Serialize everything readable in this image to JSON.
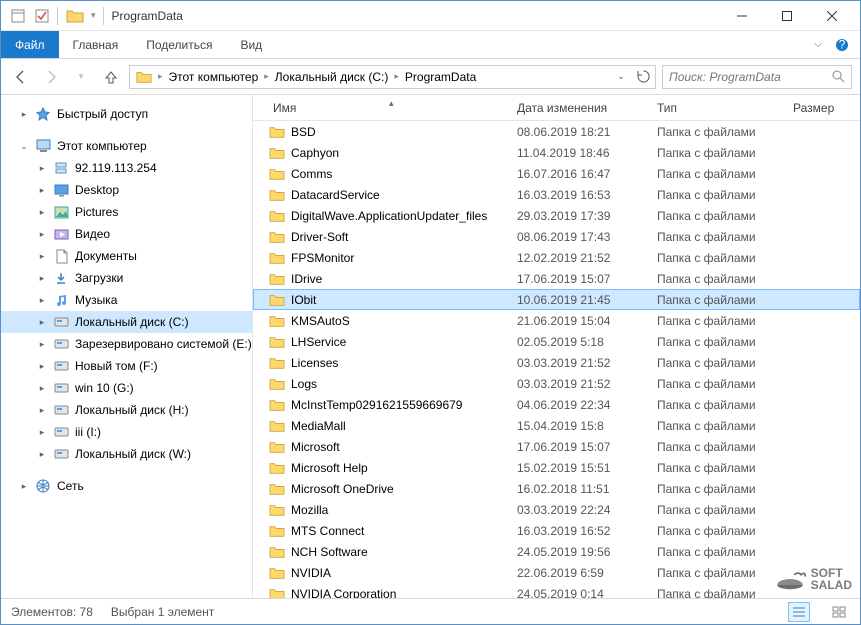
{
  "window": {
    "title": "ProgramData"
  },
  "ribbon": {
    "file": "Файл",
    "tabs": [
      "Главная",
      "Поделиться",
      "Вид"
    ]
  },
  "breadcrumb": [
    "Этот компьютер",
    "Локальный диск (C:)",
    "ProgramData"
  ],
  "search": {
    "placeholder": "Поиск: ProgramData"
  },
  "columns": {
    "name": "Имя",
    "date": "Дата изменения",
    "type": "Тип",
    "size": "Размер"
  },
  "sidebar": {
    "quick": "Быстрый доступ",
    "pc": "Этот компьютер",
    "network_ip": "92.119.113.254",
    "items": [
      "Desktop",
      "Pictures",
      "Видео",
      "Документы",
      "Загрузки",
      "Музыка"
    ],
    "localC": "Локальный диск (C:)",
    "drives": [
      "Зарезервировано системой (E:)",
      "Новый том (F:)",
      "win 10 (G:)",
      "Локальный диск (H:)",
      "iii (I:)",
      "Локальный диск (W:)"
    ],
    "network": "Сеть"
  },
  "files": [
    {
      "name": "BSD",
      "date": "08.06.2019 18:21",
      "type": "Папка с файлами"
    },
    {
      "name": "Caphyon",
      "date": "11.04.2019 18:46",
      "type": "Папка с файлами"
    },
    {
      "name": "Comms",
      "date": "16.07.2016 16:47",
      "type": "Папка с файлами"
    },
    {
      "name": "DatacardService",
      "date": "16.03.2019 16:53",
      "type": "Папка с файлами"
    },
    {
      "name": "DigitalWave.ApplicationUpdater_files",
      "date": "29.03.2019 17:39",
      "type": "Папка с файлами"
    },
    {
      "name": "Driver-Soft",
      "date": "08.06.2019 17:43",
      "type": "Папка с файлами"
    },
    {
      "name": "FPSMonitor",
      "date": "12.02.2019 21:52",
      "type": "Папка с файлами"
    },
    {
      "name": "IDrive",
      "date": "17.06.2019 15:07",
      "type": "Папка с файлами"
    },
    {
      "name": "IObit",
      "date": "10.06.2019 21:45",
      "type": "Папка с файлами",
      "selected": true
    },
    {
      "name": "KMSAutoS",
      "date": "21.06.2019 15:04",
      "type": "Папка с файлами"
    },
    {
      "name": "LHService",
      "date": "02.05.2019 5:18",
      "type": "Папка с файлами"
    },
    {
      "name": "Licenses",
      "date": "03.03.2019 21:52",
      "type": "Папка с файлами"
    },
    {
      "name": "Logs",
      "date": "03.03.2019 21:52",
      "type": "Папка с файлами"
    },
    {
      "name": "McInstTemp0291621559669679",
      "date": "04.06.2019 22:34",
      "type": "Папка с файлами"
    },
    {
      "name": "MediaMall",
      "date": "15.04.2019 15:8",
      "type": "Папка с файлами"
    },
    {
      "name": "Microsoft",
      "date": "17.06.2019 15:07",
      "type": "Папка с файлами"
    },
    {
      "name": "Microsoft Help",
      "date": "15.02.2019 15:51",
      "type": "Папка с файлами"
    },
    {
      "name": "Microsoft OneDrive",
      "date": "16.02.2018 11:51",
      "type": "Папка с файлами"
    },
    {
      "name": "Mozilla",
      "date": "03.03.2019 22:24",
      "type": "Папка с файлами"
    },
    {
      "name": "MTS Connect",
      "date": "16.03.2019 16:52",
      "type": "Папка с файлами"
    },
    {
      "name": "NCH Software",
      "date": "24.05.2019 19:56",
      "type": "Папка с файлами"
    },
    {
      "name": "NVIDIA",
      "date": "22.06.2019 6:59",
      "type": "Папка с файлами"
    },
    {
      "name": "NVIDIA Corporation",
      "date": "24.05.2019 0:14",
      "type": "Папка с файлами"
    }
  ],
  "status": {
    "total_count": 78,
    "total_label": "Элементов: 78",
    "selection": "Выбран 1 элемент"
  },
  "watermark": {
    "line1": "SOFT",
    "line2": "SALAD"
  }
}
